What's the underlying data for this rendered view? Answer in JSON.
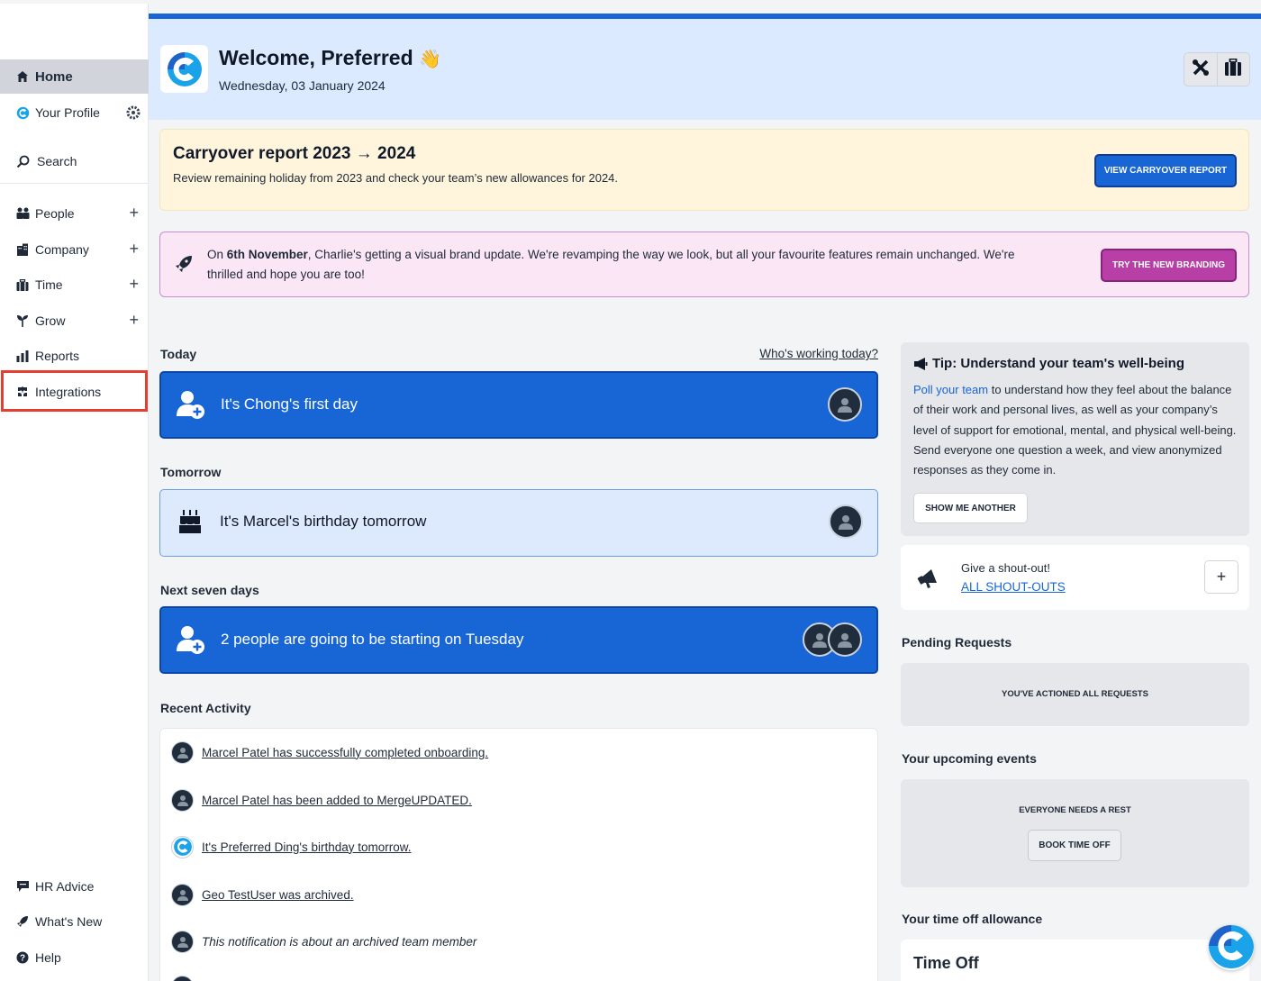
{
  "sidebar": {
    "home": "Home",
    "profile": "Your Profile",
    "search": "Search",
    "people": "People",
    "company": "Company",
    "time": "Time",
    "grow": "Grow",
    "reports": "Reports",
    "integrations": "Integrations",
    "hr_advice": "HR Advice",
    "whats_new": "What's New",
    "help": "Help"
  },
  "header": {
    "welcome": "Welcome, Preferred",
    "wave": "👋",
    "date": "Wednesday, 03 January 2024"
  },
  "carryover": {
    "title": "Carryover report 2023 → 2024",
    "subtitle": "Review remaining holiday from 2023 and check your team’s new allowances for 2024.",
    "button": "VIEW CARRYOVER REPORT"
  },
  "branding": {
    "prefix": "On ",
    "date_bold": "6th November",
    "text": ", Charlie's getting a visual brand update. We're revamping the way we look, but all your favourite features remain unchanged. We're thrilled and hope you are too!",
    "button": "TRY THE NEW BRANDING"
  },
  "today": {
    "label": "Today",
    "link": "Who's working today?",
    "card": "It's Chong's first day"
  },
  "tomorrow": {
    "label": "Tomorrow",
    "card": "It's Marcel's birthday tomorrow"
  },
  "next_seven": {
    "label": "Next seven days",
    "card": "2 people are going to be starting on Tuesday"
  },
  "recent": {
    "label": "Recent Activity",
    "items": [
      "Marcel Patel has successfully completed onboarding.",
      "Marcel Patel has been added to MergeUPDATED.",
      "It's Preferred Ding's birthday tomorrow.",
      "Geo TestUser was archived.",
      "This notification is about an archived team member"
    ]
  },
  "tip": {
    "title": "Tip: Understand your team's well-being",
    "link": "Poll your team",
    "body": " to understand how they feel about the balance of their work and personal lives, as well as your company’s level of support for emotional, mental, and physical well-being. Send everyone one question a week, and view anonymized responses as they come in.",
    "button": "SHOW ME ANOTHER"
  },
  "shoutout": {
    "text": "Give a shout-out!",
    "link": "ALL SHOUT-OUTS",
    "plus": "+"
  },
  "pending": {
    "label": "Pending Requests",
    "status": "YOU'VE ACTIONED ALL REQUESTS"
  },
  "upcoming": {
    "label": "Your upcoming events",
    "status": "EVERYONE NEEDS A REST",
    "button": "BOOK TIME OFF"
  },
  "allowance": {
    "label": "Your time off allowance",
    "card_title": "Time Off"
  },
  "colors": {
    "accent": "#1865d6",
    "header_bg": "#dbeafe",
    "carryover_bg": "#fef5dc",
    "branding_bg": "#fbe6f6",
    "branding_button": "#b73fa6",
    "highlight": "#e53e2e"
  }
}
